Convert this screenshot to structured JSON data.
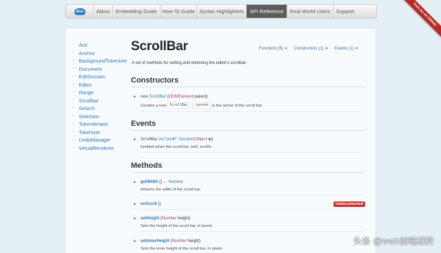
{
  "nav": {
    "logo_text": "Ace",
    "items": [
      "About",
      "Embedding Guide",
      "How-To Guide",
      "Syntax Highlighters",
      "API Reference",
      "Real World Users",
      "Support"
    ],
    "active_index": 4
  },
  "ribbon": "Fork me on GitHub",
  "sidebar": {
    "items": [
      "Ace",
      "Anchor",
      "BackgroundTokenizer",
      "Document",
      "EditSession",
      "Editor",
      "Range",
      "Scrollbar",
      "Search",
      "Selection",
      "TokenIterator",
      "Tokenizer",
      "UndoManager",
      "VirtualRenderer"
    ]
  },
  "page": {
    "title": "ScrollBar",
    "description": "A set of methods for setting and retrieving the editor's scrollbar."
  },
  "filters": {
    "functions": "Functions (5)",
    "constructors": "Constructors (1)",
    "events": "Events (1)"
  },
  "sections": {
    "constructors": "Constructors",
    "events": "Events",
    "methods": "Methods"
  },
  "constructor": {
    "kw_new": "new",
    "name": "ScrollBar",
    "paren_open": "(",
    "param_type": "DOMElement",
    "param_name": "parent)",
    "desc_pre": "Creates a new",
    "code_1": "ScrollBar",
    "code_2": ".parent",
    "desc_post": "is the owner of the scroll bar."
  },
  "event": {
    "object": "ScrollBar",
    "method": ".on(",
    "event_name": "\"scroll\"",
    "comma_fn": ", function(",
    "param_type": "Object",
    "param_name": "e",
    "close": "))",
    "desc": "Emitted when the scroll bar, well, scrolls."
  },
  "methods": [
    {
      "name": "getWidth",
      "sig": "()",
      "arrow": "→",
      "returns": "Number",
      "desc": "Returns the width of the scroll bar.",
      "badge": ""
    },
    {
      "name": "onScroll",
      "sig": "()",
      "arrow": "",
      "returns": "",
      "desc": "",
      "badge": "Undocumented"
    },
    {
      "name": "setHeight",
      "sig_open": "(",
      "param_type": "Number",
      "param_name": "height)",
      "desc": "Sets the height of the scroll bar, in pixels."
    },
    {
      "name": "setInnerHeight",
      "sig_open": "(",
      "param_type": "Number",
      "param_name": "height)",
      "desc": "Sets the inner height of the scroll bar, in pixels."
    }
  ],
  "watermark": "头条 @web前端进阶",
  "colors": {
    "background": "#e4eff6",
    "link": "#2a7ab8",
    "type": "#a23a7f",
    "active_nav": "#5c5c5c",
    "badge": "#c9302c",
    "ribbon": "#b52b27"
  }
}
